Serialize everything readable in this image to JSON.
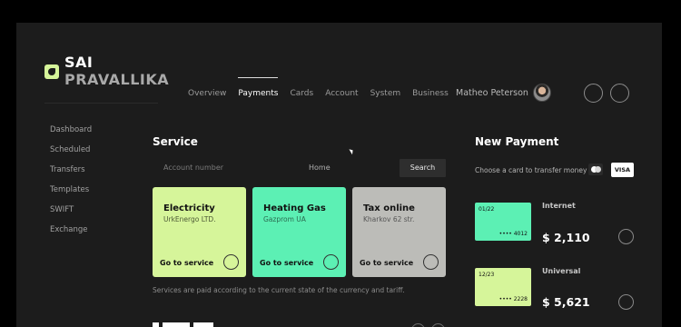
{
  "brand": {
    "line1": "SAI",
    "line2": "PRAVALLIKA"
  },
  "nav": {
    "items": [
      {
        "label": "Overview",
        "active": false
      },
      {
        "label": "Payments",
        "active": true
      },
      {
        "label": "Cards",
        "active": false
      },
      {
        "label": "Account",
        "active": false
      },
      {
        "label": "System",
        "active": false
      },
      {
        "label": "Business",
        "active": false
      }
    ]
  },
  "user": {
    "name": "Matheo Peterson",
    "avatar_icon": "user-avatar"
  },
  "sidebar": {
    "items": [
      {
        "label": "Dashboard"
      },
      {
        "label": "Scheduled"
      },
      {
        "label": "Transfers"
      },
      {
        "label": "Templates"
      },
      {
        "label": "SWIFT"
      },
      {
        "label": "Exchange"
      }
    ]
  },
  "service": {
    "title": "Service",
    "search": {
      "account_placeholder": "Account number",
      "home_value": "Home",
      "button_label": "Search"
    },
    "cards": [
      {
        "title": "Electricity",
        "subtitle": "UrkEnergo LTD.",
        "action": "Go to service",
        "color": "#d6f59a"
      },
      {
        "title": "Heating Gas",
        "subtitle": "Gazprom UA",
        "action": "Go to service",
        "color": "#5cf0b4"
      },
      {
        "title": "Tax online",
        "subtitle": "Kharkov 62 str.",
        "action": "Go to service",
        "color": "#bcbcb8"
      }
    ],
    "note": "Services are paid according to the current state of the currency and tariff."
  },
  "new_payment": {
    "title": "New Payment",
    "choose_text": "Choose a card to transfer money",
    "visa_label": "VISA",
    "payments": [
      {
        "card_date": "01/22",
        "card_number": "•••• 4012",
        "label": "Internet",
        "amount": "$ 2,110",
        "color": "#5cf0b4"
      },
      {
        "card_date": "12/23",
        "card_number": "•••• 2228",
        "label": "Universal",
        "amount": "$ 5,621",
        "color": "#d6f59a"
      }
    ]
  },
  "colors": {
    "background": "#1c1c1c",
    "accent_lime": "#d6f59a",
    "accent_mint": "#5cf0b4",
    "accent_gray": "#bcbcb8"
  }
}
